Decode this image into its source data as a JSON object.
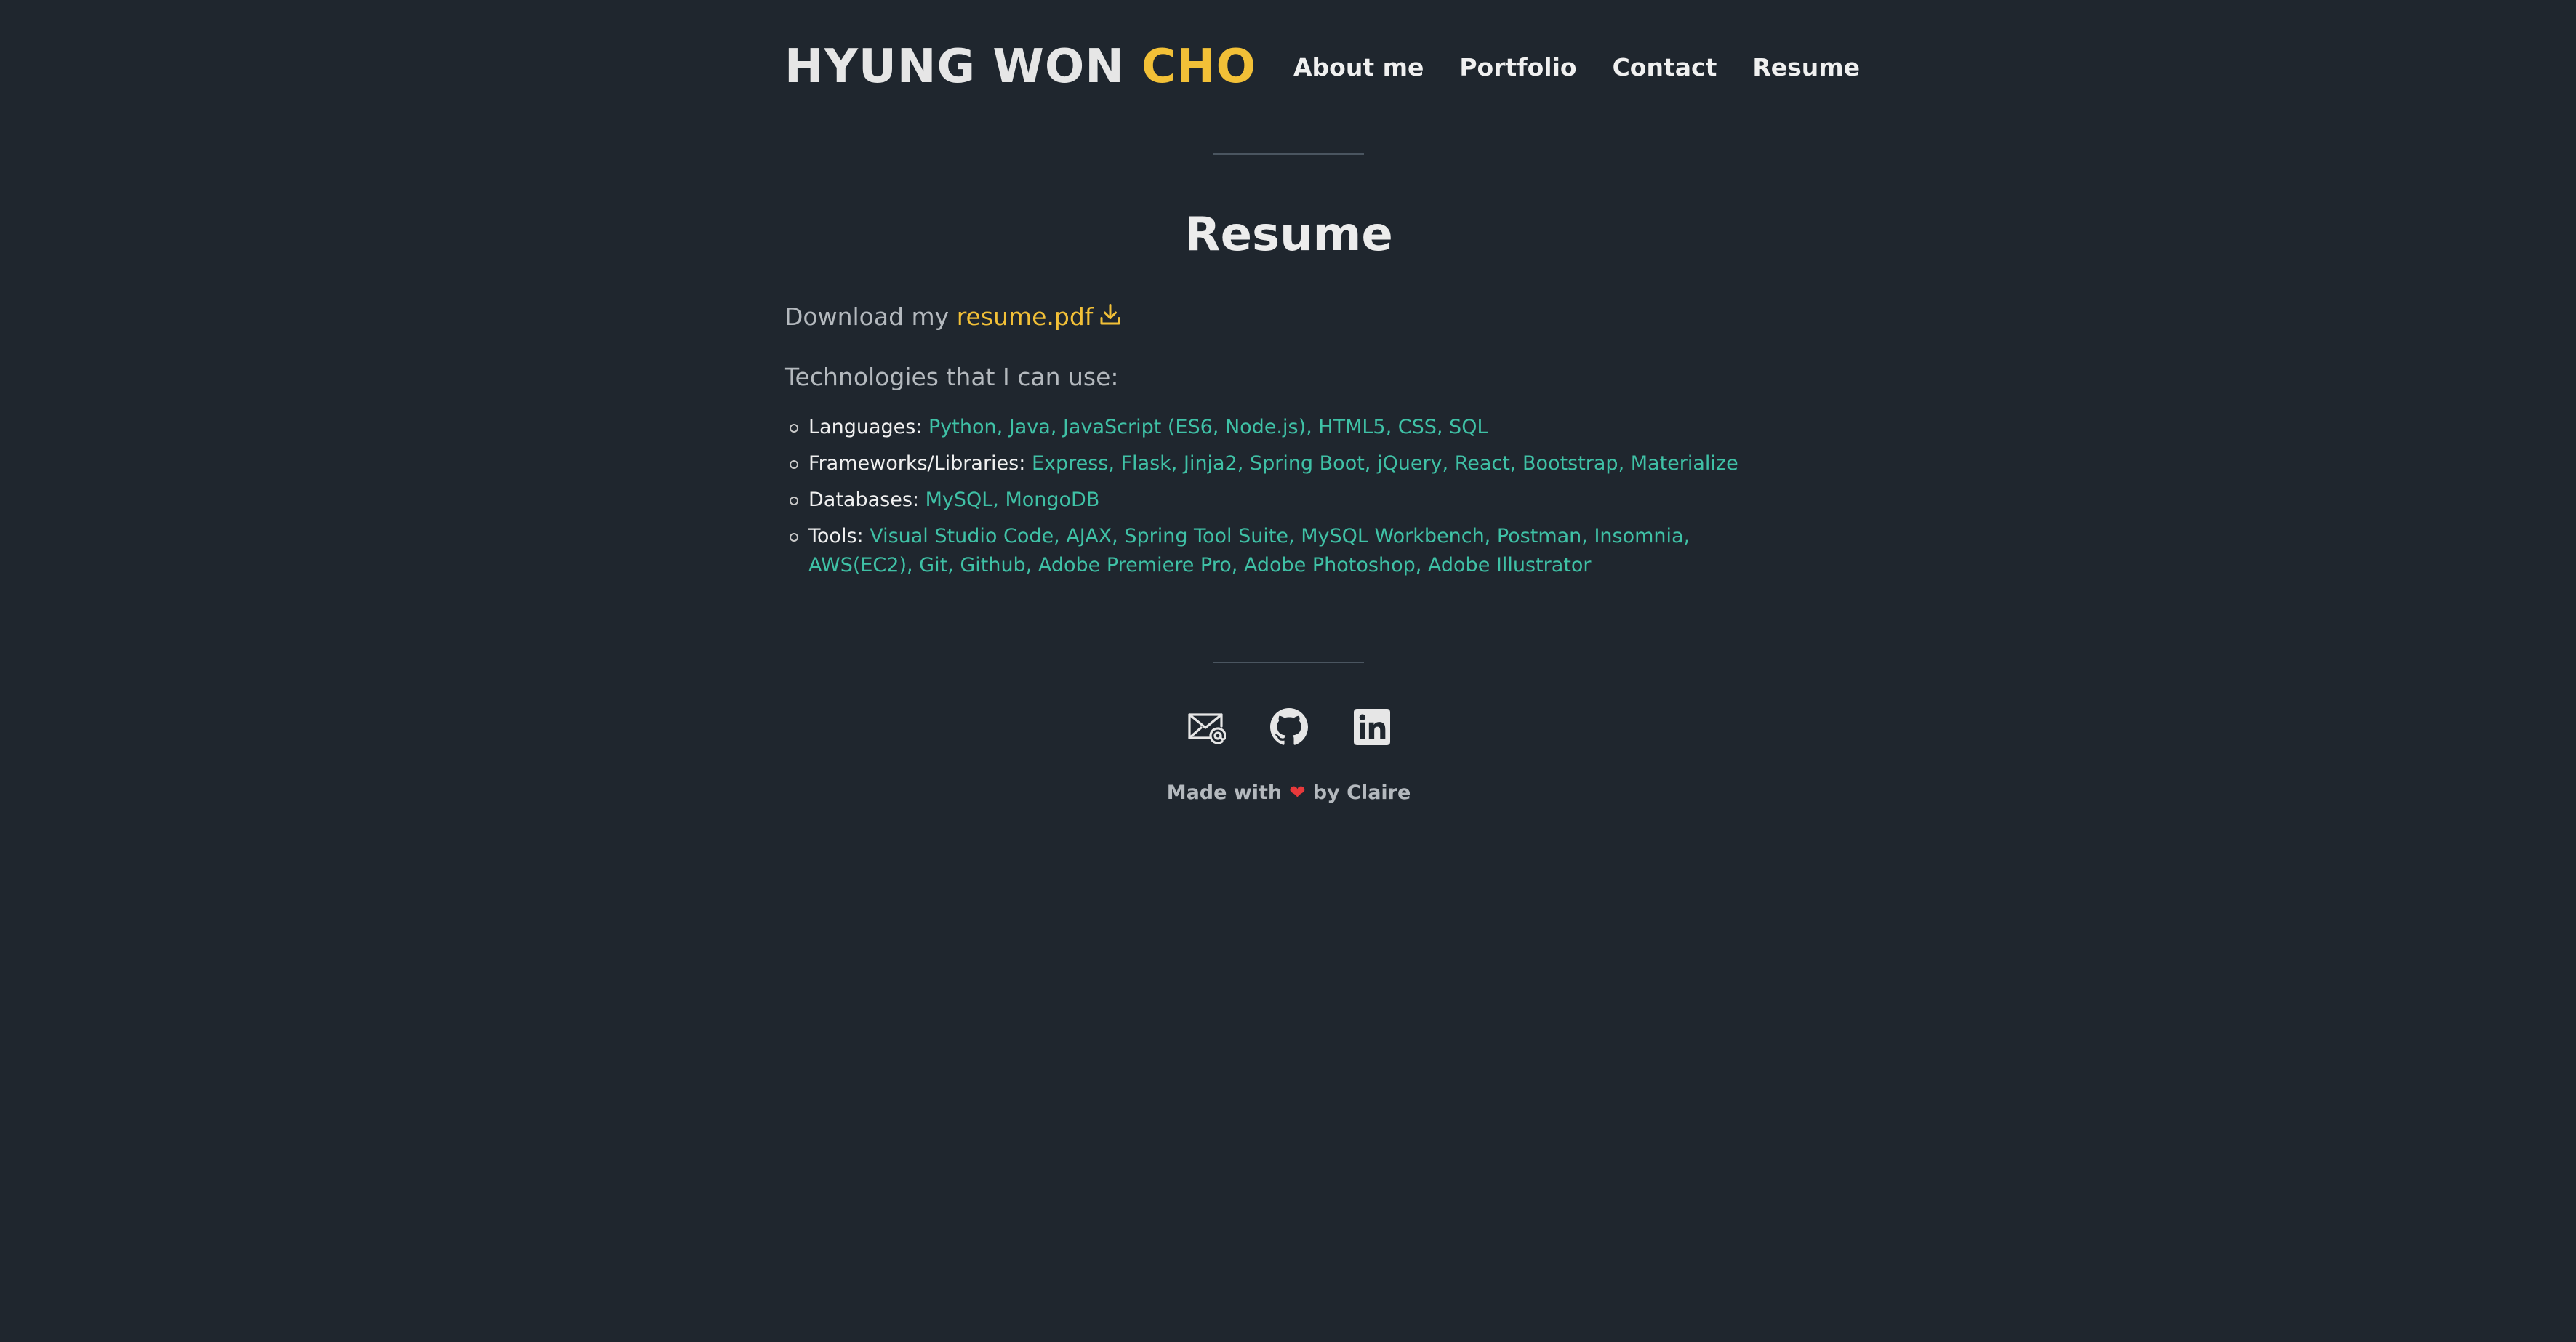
{
  "header": {
    "logo_first": "HYUNG WON",
    "logo_last": "CHO",
    "nav": [
      {
        "label": "About me"
      },
      {
        "label": "Portfolio"
      },
      {
        "label": "Contact"
      },
      {
        "label": "Resume"
      }
    ]
  },
  "main": {
    "title": "Resume",
    "download_prefix": "Download my",
    "download_link": "resume.pdf",
    "tech_intro": "Technologies that I can use:",
    "tech": [
      {
        "label": "Languages:",
        "items": "Python, Java, JavaScript (ES6, Node.js), HTML5, CSS, SQL"
      },
      {
        "label": "Frameworks/Libraries:",
        "items": "Express, Flask, Jinja2, Spring Boot, jQuery, React, Bootstrap, Materialize"
      },
      {
        "label": "Databases:",
        "items": "MySQL, MongoDB"
      },
      {
        "label": "Tools:",
        "items": "Visual Studio Code, AJAX, Spring Tool Suite, MySQL Workbench, Postman, Insomnia, AWS(EC2), Git, Github, Adobe Premiere Pro, Adobe Photoshop, Adobe Illustrator"
      }
    ]
  },
  "footer": {
    "icons": [
      "email-icon",
      "github-icon",
      "linkedin-icon"
    ],
    "made_with": "Made with",
    "by": "by Claire"
  },
  "colors": {
    "background": "#1f262e",
    "accent": "#f2c037",
    "tech_items": "#3fc1a6",
    "heart": "#e8393b"
  }
}
